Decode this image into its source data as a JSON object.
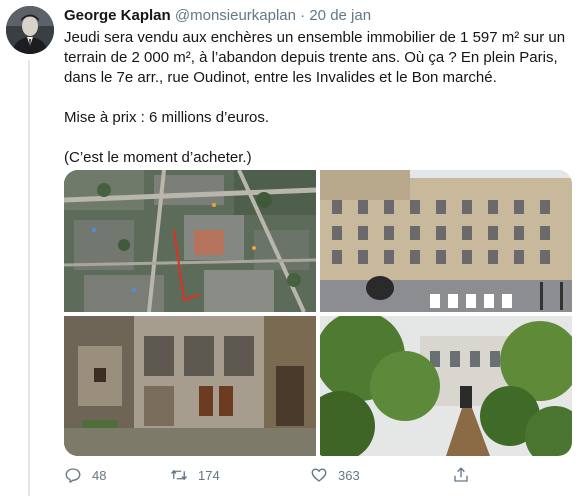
{
  "tweet": {
    "author_name": "George Kaplan",
    "author_handle": "@monsieurkaplan",
    "separator": "·",
    "date": "20 de jan",
    "paragraph_1": "Jeudi sera vendu aux enchères un ensemble immobilier de 1 597 m² sur un terrain de 2 000 m², à l’abandon depuis trente ans. Où ça ? En plein Paris, dans le 7e arr., rue Oudinot, entre les Invalides et le Bon marché.",
    "paragraph_2": "Mise à prix : 6 millions d’euros.",
    "paragraph_3": "(C’est le moment d’acheter.)"
  },
  "media": [
    {
      "icon": "aerial-map-photo"
    },
    {
      "icon": "building-facade-photo"
    },
    {
      "icon": "courtyard-timber-photo"
    },
    {
      "icon": "overgrown-garden-photo"
    }
  ],
  "actions": {
    "reply_count": "48",
    "retweet_count": "174",
    "like_count": "363"
  },
  "colors": {
    "text": "#14171a",
    "secondary": "#657786",
    "divider": "#e1e8ed"
  }
}
